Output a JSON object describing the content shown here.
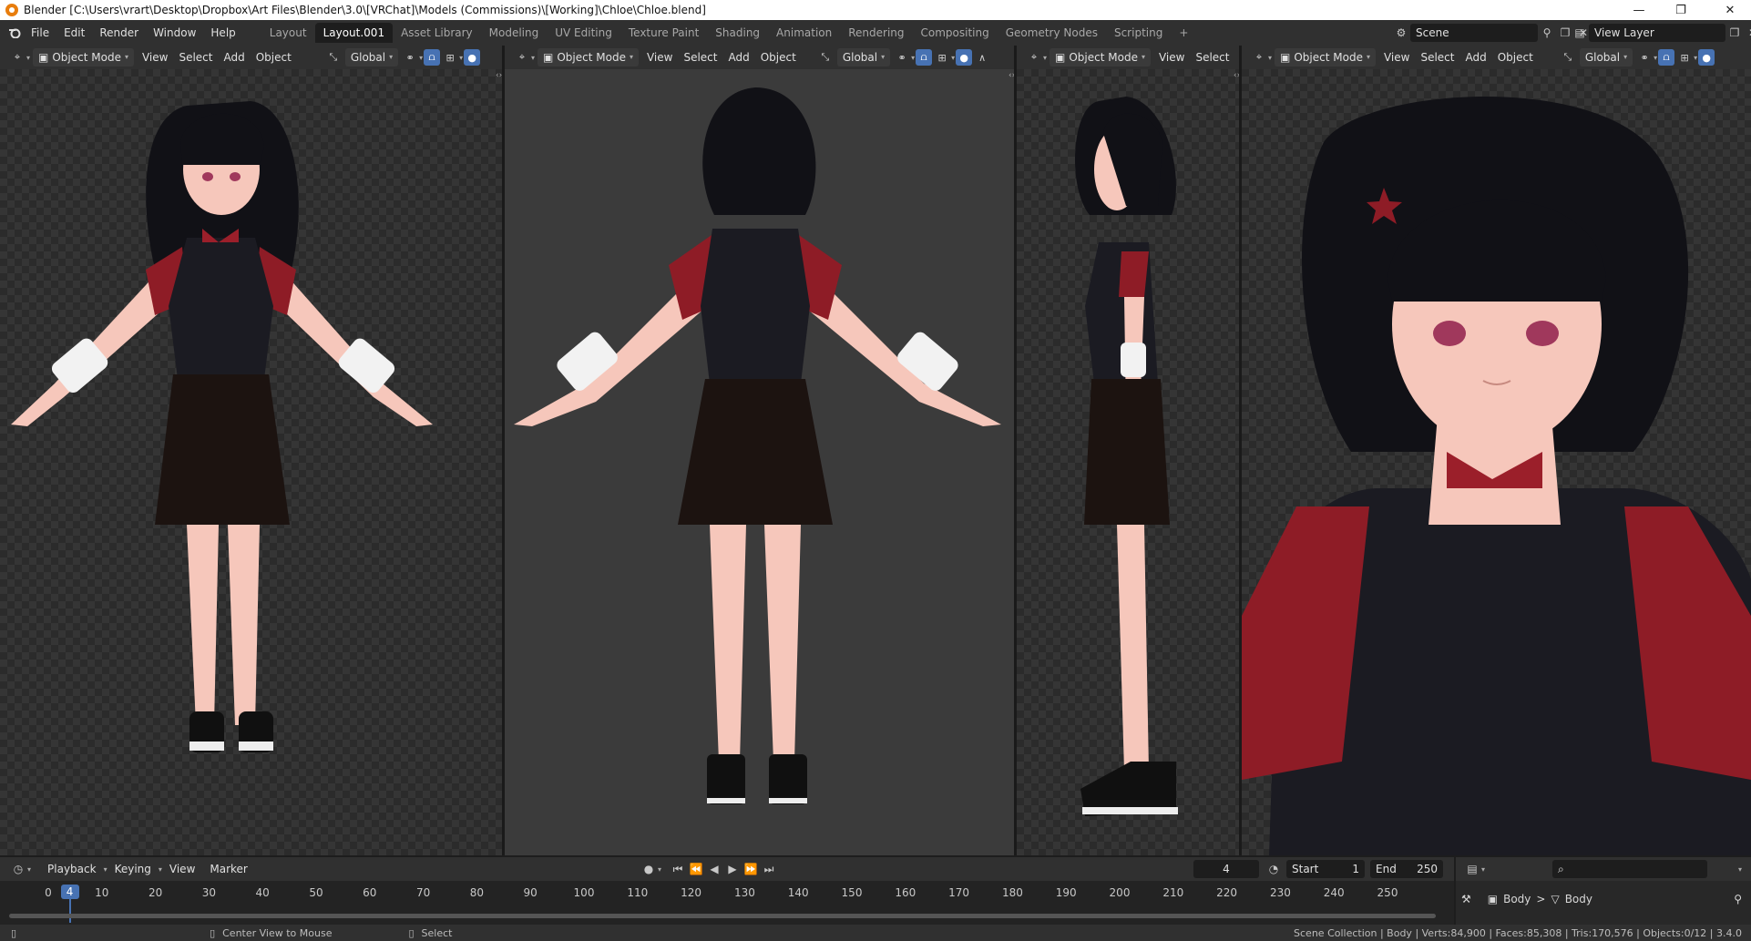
{
  "window": {
    "title": "Blender [C:\\Users\\vrart\\Desktop\\Dropbox\\Art Files\\Blender\\3.0\\[VRChat]\\Models (Commissions)\\[Working]\\Chloe\\Chloe.blend]",
    "controls": [
      "—",
      "❐",
      "✕"
    ]
  },
  "menu": [
    "File",
    "Edit",
    "Render",
    "Window",
    "Help"
  ],
  "workspaces": [
    {
      "label": "Layout",
      "active": false
    },
    {
      "label": "Layout.001",
      "active": true
    },
    {
      "label": "Asset Library",
      "active": false
    },
    {
      "label": "Modeling",
      "active": false
    },
    {
      "label": "UV Editing",
      "active": false
    },
    {
      "label": "Texture Paint",
      "active": false
    },
    {
      "label": "Shading",
      "active": false
    },
    {
      "label": "Animation",
      "active": false
    },
    {
      "label": "Rendering",
      "active": false
    },
    {
      "label": "Compositing",
      "active": false
    },
    {
      "label": "Geometry Nodes",
      "active": false
    },
    {
      "label": "Scripting",
      "active": false
    }
  ],
  "add_workspace": "+",
  "scene": {
    "label": "Scene"
  },
  "view_layer": {
    "label": "View Layer"
  },
  "viewports": [
    {
      "mode": "Object Mode",
      "menus": [
        "View",
        "Select",
        "Add",
        "Object"
      ],
      "orientation": "Global",
      "view": "front"
    },
    {
      "mode": "Object Mode",
      "menus": [
        "View",
        "Select",
        "Add",
        "Object"
      ],
      "orientation": "Global",
      "view": "back"
    },
    {
      "mode": "Object Mode",
      "menus": [
        "View",
        "Select"
      ],
      "orientation": "",
      "view": "side"
    },
    {
      "mode": "Object Mode",
      "menus": [
        "View",
        "Select",
        "Add",
        "Object"
      ],
      "orientation": "Global",
      "view": "closeup"
    }
  ],
  "timeline": {
    "menus": [
      "Playback",
      "Keying",
      "View",
      "Marker"
    ],
    "current_frame": "4",
    "start_label": "Start",
    "start": "1",
    "end_label": "End",
    "end": "250",
    "ticks": [
      "0",
      "10",
      "20",
      "30",
      "40",
      "50",
      "60",
      "70",
      "80",
      "90",
      "100",
      "110",
      "120",
      "130",
      "140",
      "150",
      "160",
      "170",
      "180",
      "190",
      "200",
      "210",
      "220",
      "230",
      "240",
      "250"
    ],
    "transport": [
      "⏮",
      "⏪",
      "◀",
      "▶",
      "⏩",
      "⏭"
    ]
  },
  "outliner": {
    "breadcrumb_1": "Body",
    "breadcrumb_sep": ">",
    "breadcrumb_2": "Body"
  },
  "statusbar": {
    "hint_1": "Center View to Mouse",
    "hint_2": "Select",
    "stats": "Scene Collection | Body | Verts:84,900 | Faces:85,308 | Tris:170,576 | Objects:0/12 | 3.4.0"
  },
  "colors": {
    "accent": "#4772b3",
    "shirt": "#1b1b22",
    "sleeve": "#8e1c26",
    "hair": "#111116",
    "skin": "#f6c7bb",
    "skirt": "#1c1310"
  }
}
